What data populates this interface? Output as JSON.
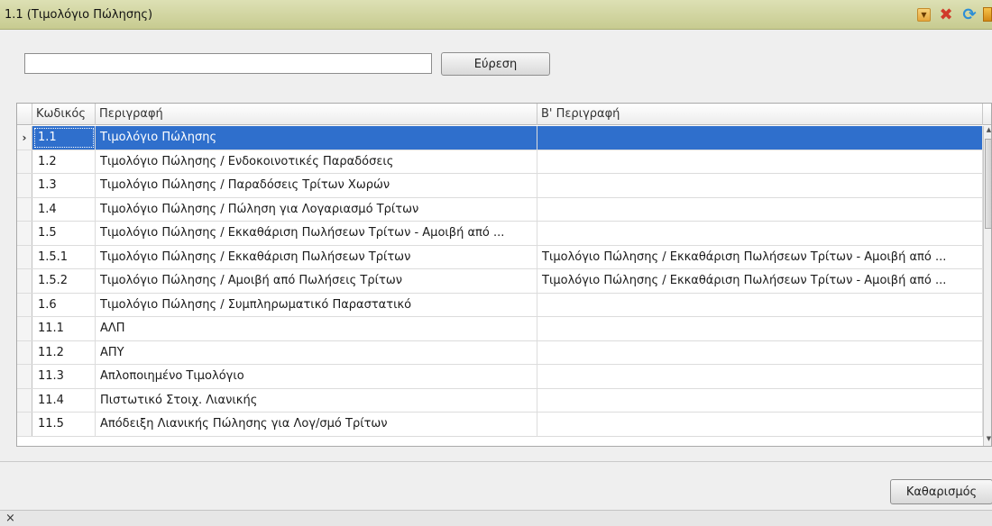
{
  "window": {
    "title": "1.1 (Τιμολόγιο Πώλησης)",
    "icons": [
      "dropdown-icon",
      "close-icon",
      "refresh-icon",
      "extra-icon"
    ]
  },
  "search": {
    "value": "",
    "button_label": "Εύρεση"
  },
  "table": {
    "columns": [
      "Κωδικός",
      "Περιγραφή",
      "Β' Περιγραφή"
    ],
    "rows": [
      {
        "code": "1.1",
        "desc": "Τιμολόγιο Πώλησης",
        "desc2": "",
        "selected": true
      },
      {
        "code": "1.2",
        "desc": "Τιμολόγιο Πώλησης / Ενδοκοινοτικές Παραδόσεις",
        "desc2": ""
      },
      {
        "code": "1.3",
        "desc": "Τιμολόγιο Πώλησης / Παραδόσεις Τρίτων Χωρών",
        "desc2": ""
      },
      {
        "code": "1.4",
        "desc": "Τιμολόγιο Πώλησης / Πώληση για Λογαριασμό Τρίτων",
        "desc2": ""
      },
      {
        "code": "1.5",
        "desc": "Τιμολόγιο Πώλησης / Εκκαθάριση Πωλήσεων Τρίτων - Αμοιβή από ...",
        "desc2": ""
      },
      {
        "code": "1.5.1",
        "desc": "Τιμολόγιο Πώλησης / Εκκαθάριση Πωλήσεων Τρίτων",
        "desc2": "Τιμολόγιο Πώλησης / Εκκαθάριση Πωλήσεων Τρίτων - Αμοιβή από ..."
      },
      {
        "code": "1.5.2",
        "desc": "Τιμολόγιο Πώλησης / Αμοιβή από Πωλήσεις Τρίτων",
        "desc2": "Τιμολόγιο Πώλησης / Εκκαθάριση Πωλήσεων Τρίτων - Αμοιβή από ..."
      },
      {
        "code": "1.6",
        "desc": "Τιμολόγιο Πώλησης / Συμπληρωματικό Παραστατικό",
        "desc2": ""
      },
      {
        "code": "11.1",
        "desc": "ΑΛΠ",
        "desc2": ""
      },
      {
        "code": "11.2",
        "desc": "ΑΠΥ",
        "desc2": ""
      },
      {
        "code": "11.3",
        "desc": "Απλοποιημένο Τιμολόγιο",
        "desc2": ""
      },
      {
        "code": "11.4",
        "desc": "Πιστωτικό Στοιχ. Λιανικής",
        "desc2": ""
      },
      {
        "code": "11.5",
        "desc": "Απόδειξη Λιανικής Πώλησης για Λογ/σμό Τρίτων",
        "desc2": ""
      }
    ],
    "row_indicator": "›"
  },
  "actions": {
    "clear_label": "Καθαρισμός"
  },
  "footer": {
    "close_glyph": "×"
  },
  "colors": {
    "titlebar": "#d4d7a6",
    "selection": "#2f6fcc"
  }
}
